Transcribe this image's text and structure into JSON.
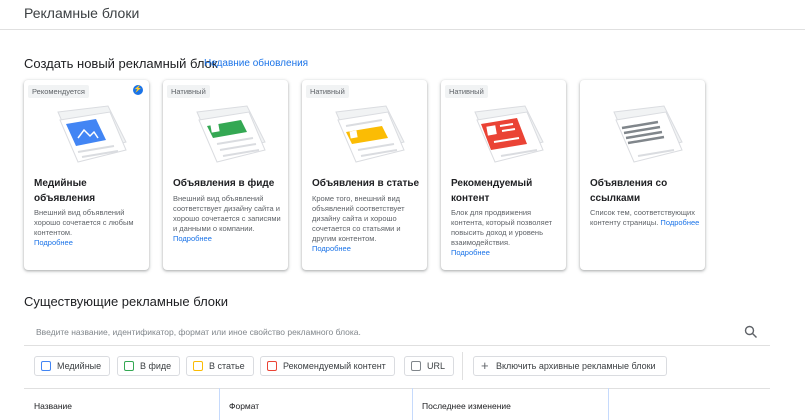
{
  "header": {
    "title": "Рекламные блоки"
  },
  "create": {
    "title": "Создать новый рекламный блок",
    "recent_link": "Недавние обновления",
    "cards": [
      {
        "badge": "Рекомендуется",
        "title": "Медийные объявления",
        "desc": "Внешний вид объявлений хорошо сочетается с любым контентом.",
        "more": "Подробнее",
        "accent": "#4285f4"
      },
      {
        "badge": "Нативный",
        "title": "Объявления в фиде",
        "desc": "Внешний вид объявлений соответствует дизайну сайта и хорошо сочетается с записями и данными о компании.",
        "more": "Подробнее",
        "accent": "#34a853"
      },
      {
        "badge": "Нативный",
        "title": "Объявления в статье",
        "desc": "Кроме того, внешний вид объявлений соответствует дизайну сайта и хорошо сочетается со статьями и другим контентом.",
        "more": "Подробнее",
        "accent": "#fbbc04"
      },
      {
        "badge": "Нативный",
        "title": "Рекомендуемый контент",
        "desc": "Блок для продвижения контента, который позволяет повысить доход и уровень взаимодействия.",
        "more": "Подробнее",
        "accent": "#ea4335"
      },
      {
        "badge": "",
        "title": "Объявления со ссылками",
        "desc": "Список тем, соответствующих контенту страницы.",
        "more": "Подробнее",
        "accent": "#80868b"
      }
    ]
  },
  "existing": {
    "title": "Существующие рекламные блоки",
    "search_placeholder": "Введите название, идентификатор, формат или иное свойство рекламного блока.",
    "filters": [
      {
        "label": "Медийные",
        "color": "#4285f4"
      },
      {
        "label": "В фиде",
        "color": "#34a853"
      },
      {
        "label": "В статье",
        "color": "#fbbc04"
      },
      {
        "label": "Рекомендуемый контент",
        "color": "#ea4335"
      },
      {
        "label": "URL",
        "color": "#80868b"
      }
    ],
    "archive_button": "Включить архивные рекламные блоки",
    "columns": [
      "Название",
      "Формат",
      "Последнее изменение"
    ]
  }
}
